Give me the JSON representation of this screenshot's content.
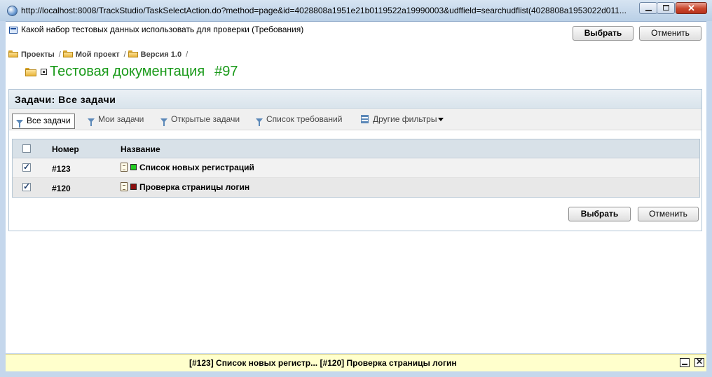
{
  "window": {
    "url": "http://localhost:8008/TrackStudio/TaskSelectAction.do?method=page&id=4028808a1951e21b0119522a19990003&udffield=searchudflist(4028808a1953022d011...",
    "close_glyph": "✕"
  },
  "header": {
    "question": "Какой набор тестовых данных использовать для проверки (Требования)",
    "select_label": "Выбрать",
    "cancel_label": "Отменить"
  },
  "breadcrumb": {
    "items": [
      "Проекты",
      "Мой проект",
      "Версия 1.0"
    ],
    "separator": "/"
  },
  "task": {
    "title": "Тестовая документация",
    "number": "#97"
  },
  "panel": {
    "title": "Задачи: Все задачи",
    "filters": [
      "Все задачи",
      "Мои задачи",
      "Открытые задачи",
      "Список требований",
      "Другие фильтры"
    ],
    "active_filter": "Все задачи"
  },
  "table": {
    "columns": [
      "Номер",
      "Название"
    ],
    "rows": [
      {
        "checked": true,
        "number": "#123",
        "name": "Список новых регистраций",
        "status_color": "#22cc22"
      },
      {
        "checked": true,
        "number": "#120",
        "name": "Проверка страницы логин",
        "status_color": "#8b0f0f"
      }
    ]
  },
  "footer_buttons": {
    "select_label": "Выбрать",
    "cancel_label": "Отменить"
  },
  "statusbar": {
    "text": "[#123] Список новых регистр... [#120] Проверка страницы логин"
  },
  "colors": {
    "task_title": "#1a9a1a",
    "statusbar_bg": "#ffffcc"
  }
}
